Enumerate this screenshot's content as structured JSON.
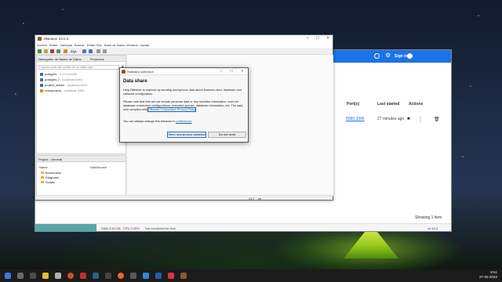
{
  "web_app": {
    "header": {
      "signin_label": "Sign in",
      "help_icon": "help-circle-icon",
      "gear_icon": "gear-icon",
      "avatar_icon": "account-circle-icon"
    },
    "table": {
      "columns": [
        "Port(s)",
        "Last started",
        "Actions"
      ],
      "row": {
        "port": "8080:3306",
        "last_started": "27 minutes ago"
      }
    },
    "showing": "Showing 1 item",
    "footer": {
      "ram": "RAM 3.60 GB",
      "cpu": "CPU 0.25%",
      "hub": "Not connected to Hub",
      "version": "v4.19.0"
    }
  },
  "dbeaver": {
    "title": "DBeaver 23.0.4",
    "menu": [
      "Archivo",
      "Editar",
      "Navegar",
      "Buscar",
      "Editor SQL",
      "Base de Datos",
      "Ventana",
      "Ayuda"
    ],
    "toolbar": {
      "sql_label": "SQL"
    },
    "nav_tabs": [
      "Navegador de Bases de Datos",
      "Proyectos"
    ],
    "filter_placeholder": "Ingrese parte del nombre de un objeto aquí",
    "connections": [
      {
        "name": "postgres",
        "host": "- 0.0.0.0:5432"
      },
      {
        "name": "postgres 2",
        "host": "- localhost:5081"
      },
      {
        "name": "project_admin",
        "host": "- localhost:5432"
      },
      {
        "name": "restaurdpos",
        "host": "- localhost:3308"
      }
    ],
    "project_panel": {
      "tab": "Project - General",
      "columns": [
        "Name",
        "DataSource"
      ],
      "items": [
        "Bookmarks",
        "Diagrams",
        "Scripts"
      ]
    },
    "status": {
      "locale": "CLT",
      "language": "es"
    }
  },
  "dialog": {
    "title": "Statistics collection",
    "heading": "Data share",
    "para1": "Help DBeaver to improve by sending anonymous data about features used, hardware and software configuration.",
    "para2_a": "Please note that this will not include personal data or any sensitive information, such as database connection configurations, executed queries, database information, etc. The data sent complies with ",
    "policy_link": "DBeaver Corporation Privacy Policy",
    "para3_a": "You can always change this behavior in ",
    "prefs_link": "preferences",
    "send_button": "Send anonymous statistics",
    "decline_button": "Do not send"
  },
  "taskbar": {
    "time": "8:51",
    "date": "27-05-2023"
  },
  "colors": {
    "accent": "#1a73e8",
    "taskbar": "#1b1b1b"
  }
}
